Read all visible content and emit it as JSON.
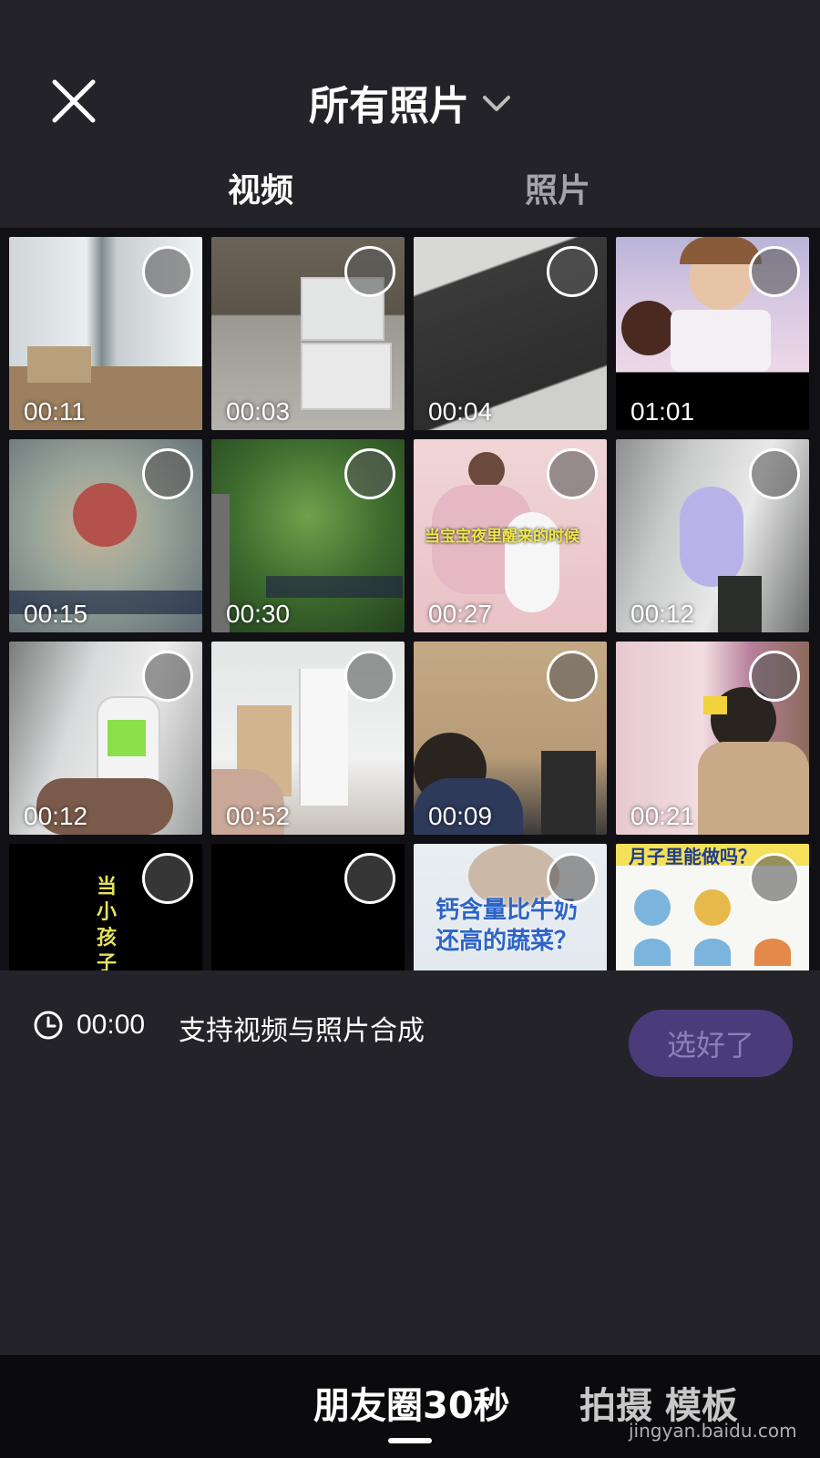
{
  "header": {
    "album_title": "所有照片",
    "tabs": [
      {
        "label": "视频",
        "active": true
      },
      {
        "label": "照片",
        "active": false
      }
    ]
  },
  "media": [
    {
      "duration": "00:11",
      "thumb": "room-corner"
    },
    {
      "duration": "00:03",
      "thumb": "white-boxes"
    },
    {
      "duration": "00:04",
      "thumb": "dark-mat"
    },
    {
      "duration": "01:01",
      "thumb": "game-character"
    },
    {
      "duration": "00:15",
      "thumb": "game-arena"
    },
    {
      "duration": "00:30",
      "thumb": "game-jungle"
    },
    {
      "duration": "00:27",
      "thumb": "baby-bed",
      "caption": "当宝宝夜里醒来的时候"
    },
    {
      "duration": "00:12",
      "thumb": "white-device"
    },
    {
      "duration": "00:12",
      "thumb": "remote-control"
    },
    {
      "duration": "00:52",
      "thumb": "hallway"
    },
    {
      "duration": "00:09",
      "thumb": "kid-cardboard"
    },
    {
      "duration": "00:21",
      "thumb": "back-massage"
    },
    {
      "duration": "",
      "thumb": "black-caption",
      "caption": "当小孩子"
    },
    {
      "duration": "",
      "thumb": "black"
    },
    {
      "duration": "",
      "thumb": "vegetable-caption",
      "caption": "钙含量比牛奶还高的蔬菜？"
    },
    {
      "duration": "",
      "thumb": "infographic",
      "caption": "月子里能做吗？"
    }
  ],
  "footer": {
    "total_duration": "00:00",
    "hint": "支持视频与照片合成",
    "done_label": "选好了"
  },
  "bottom_nav": {
    "active_label": "朋友圈30秒",
    "other_label": "拍摄  模板"
  },
  "watermark": "jingyan.baidu.com"
}
